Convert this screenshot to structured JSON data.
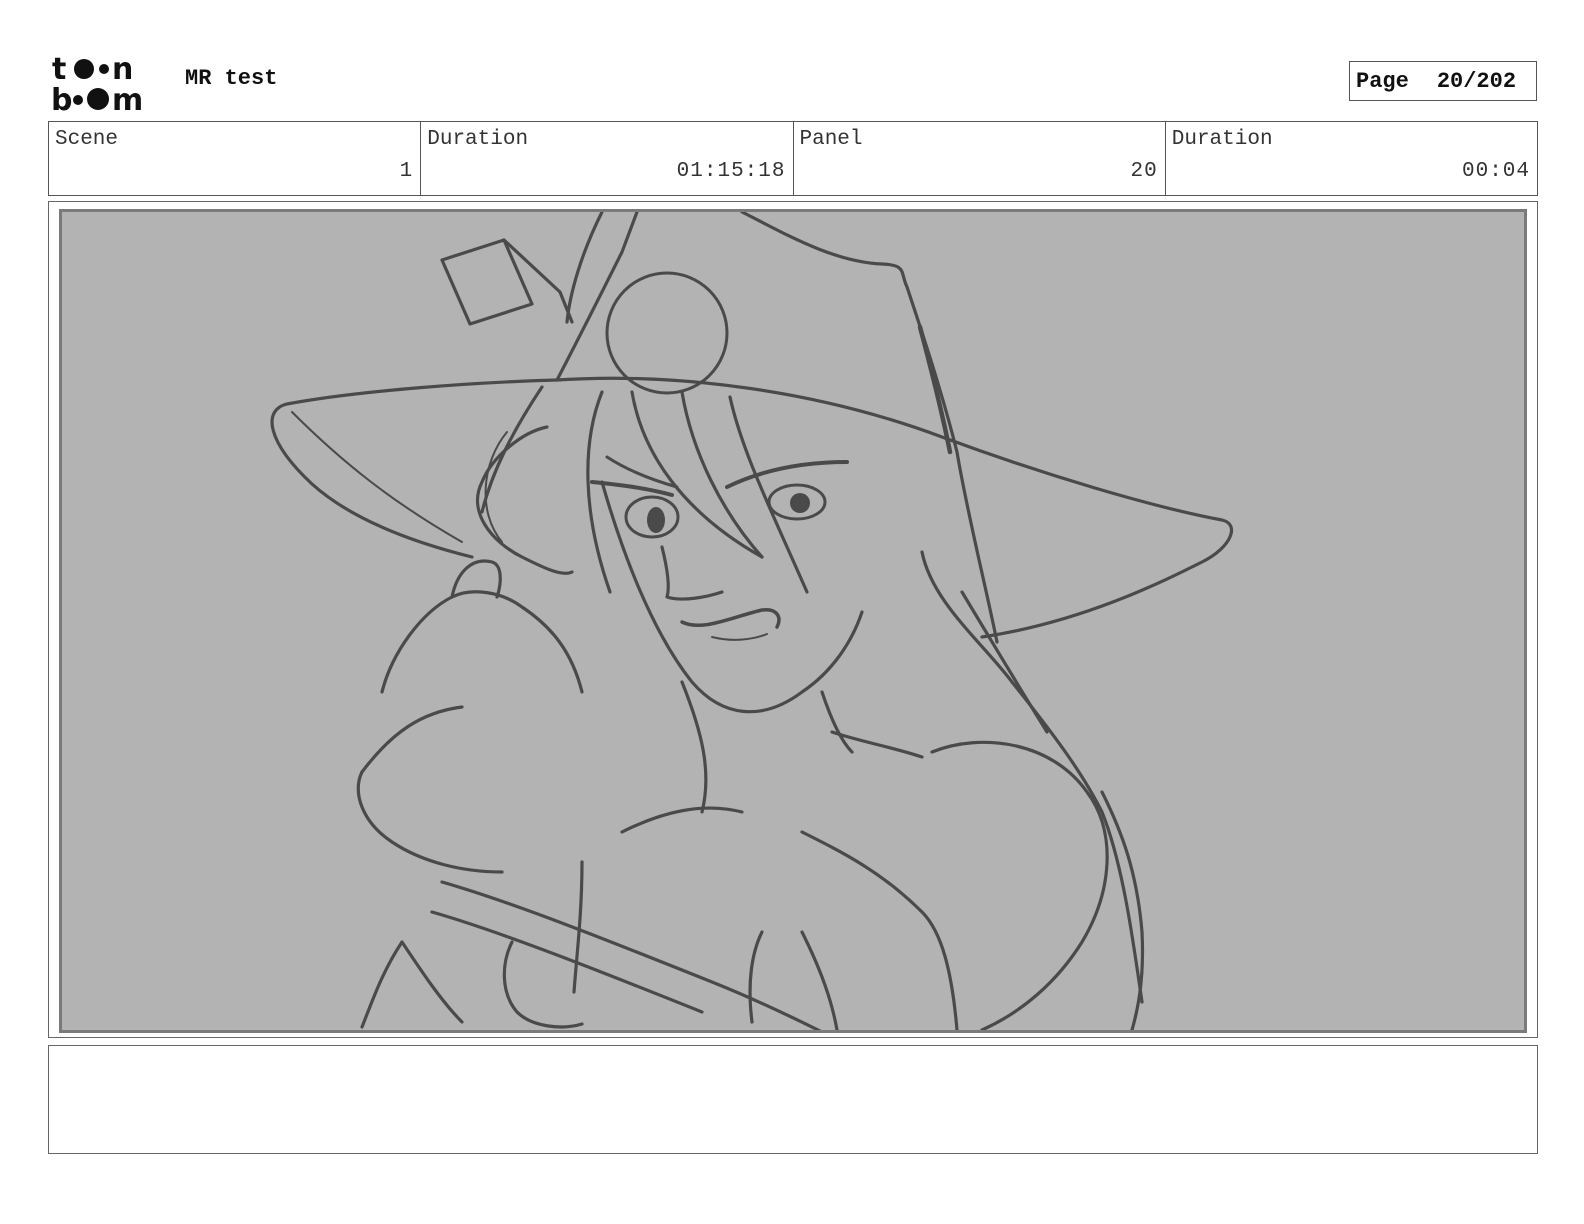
{
  "header": {
    "logo_text": "toon boom",
    "title": "MR test",
    "page_label": "Page",
    "page_value": "20/202"
  },
  "info": {
    "scene_label": "Scene",
    "scene_value": "1",
    "scene_duration_label": "Duration",
    "scene_duration_value": "01:15:18",
    "panel_label": "Panel",
    "panel_value": "20",
    "panel_duration_label": "Duration",
    "panel_duration_value": "00:04"
  },
  "colors": {
    "panel_background": "#b3b3b3",
    "sketch_line": "#4a4a4a",
    "border": "#555555"
  },
  "panel": {
    "image_content": "rough-sketch-character-with-wide-brim-hat"
  },
  "notes": {
    "text": ""
  }
}
